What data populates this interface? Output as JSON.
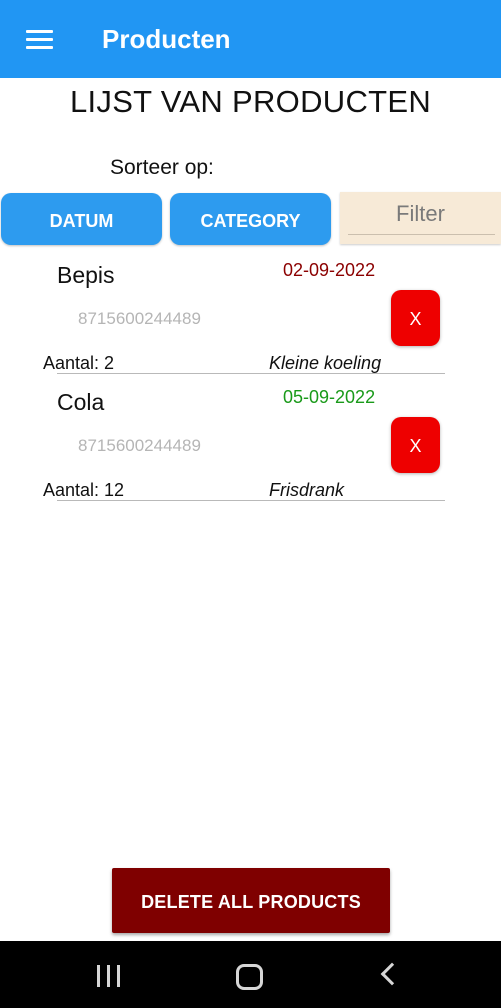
{
  "app_bar": {
    "title": "Producten",
    "menu_icon": "hamburger-menu-icon"
  },
  "page": {
    "title": "LIJST VAN PRODUCTEN",
    "sort_label": "Sorteer op:"
  },
  "sort_buttons": {
    "date_label": "DATUM",
    "category_label": "CATEGORY"
  },
  "filter": {
    "placeholder": "Filter",
    "value": ""
  },
  "products": [
    {
      "name": "Bepis",
      "date": "02-09-2022",
      "date_color": "#8b0000",
      "barcode": "8715600244489",
      "quantity": "Aantal: 2",
      "category": "Kleine koeling",
      "delete_label": "X"
    },
    {
      "name": "Cola",
      "date": "05-09-2022",
      "date_color": "#1a9a1a",
      "barcode": "8715600244489",
      "quantity": "Aantal: 12",
      "category": "Frisdrank",
      "delete_label": "X"
    }
  ],
  "delete_all_label": "DELETE ALL PRODUCTS",
  "nav_bar": {
    "recents_icon": "recents-icon",
    "home_icon": "home-icon",
    "back_icon": "back-icon"
  },
  "colors": {
    "app_bar": "#2196f3",
    "sort_button": "#2d9bef",
    "filter_bg": "#f7ead7",
    "delete_button": "#ee0000",
    "delete_all": "#7f0000"
  }
}
